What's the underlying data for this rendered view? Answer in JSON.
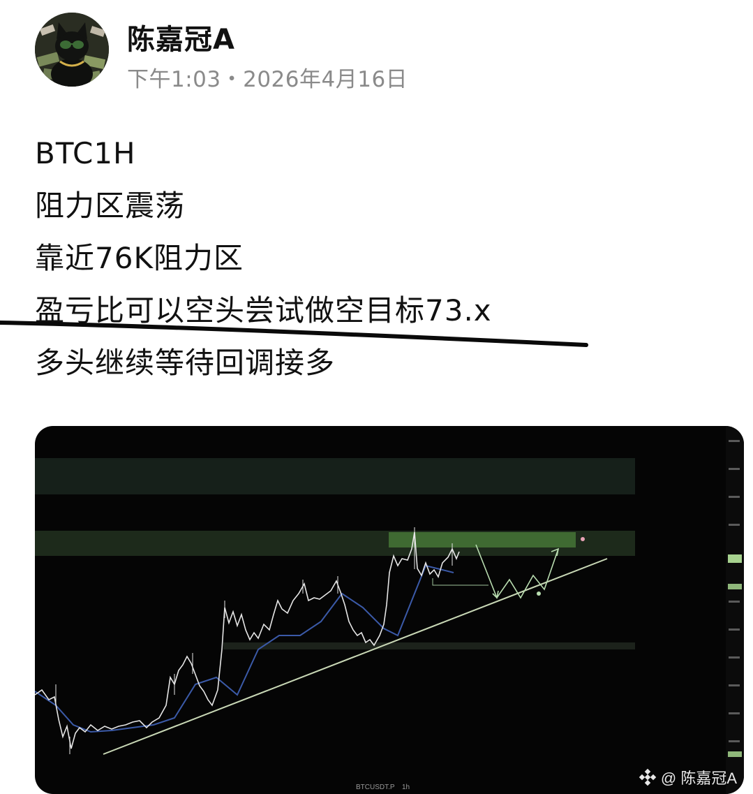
{
  "author": {
    "name": "陈嘉冠A",
    "timestamp": "下午1:03・2026年4月16日"
  },
  "post": {
    "lines": [
      "BTC1H",
      "阻力区震荡",
      "靠近76K阻力区",
      "盈亏比可以空头尝试做空目标73.x",
      "多头继续等待回调接多"
    ]
  },
  "chart": {
    "symbol": "BTCUSDT.P",
    "interval": "1h",
    "watermark": "@ 陈嘉冠A",
    "colors": {
      "background": "#050505",
      "zone": "#1d2a1b",
      "zone_highlight": "#3f6a32",
      "candles": "#e6e6e6",
      "trendline": "#c9d8b6",
      "projection": "#b9ddb0",
      "ma": "#3b5aa8"
    }
  }
}
